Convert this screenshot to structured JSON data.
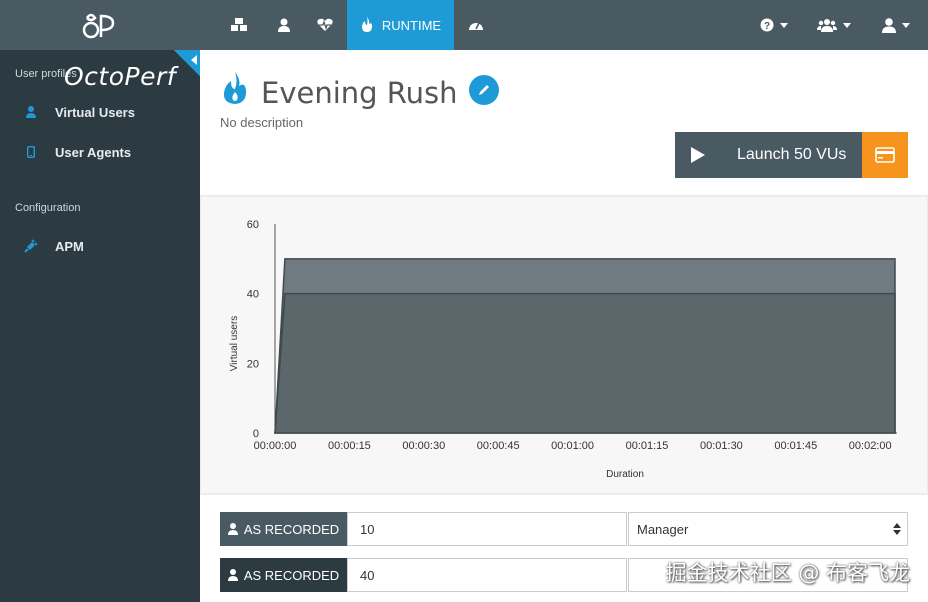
{
  "brand": {
    "name": "OctoPerf"
  },
  "topnav": {
    "items": [
      {
        "icon": "cubes-icon"
      },
      {
        "icon": "user-icon"
      },
      {
        "icon": "heartbeat-icon"
      },
      {
        "icon": "flame-icon",
        "label": "RUNTIME",
        "active": true
      },
      {
        "icon": "dashboard-icon"
      }
    ],
    "right": [
      {
        "icon": "help-icon"
      },
      {
        "icon": "team-icon"
      },
      {
        "icon": "account-icon"
      }
    ]
  },
  "sidebar": {
    "sections": [
      {
        "title": "User profiles",
        "items": [
          {
            "label": "Virtual Users",
            "icon": "user-icon"
          },
          {
            "label": "User Agents",
            "icon": "mobile-icon"
          }
        ]
      },
      {
        "title": "Configuration",
        "items": [
          {
            "label": "APM",
            "icon": "plug-icon"
          }
        ]
      }
    ]
  },
  "scenario": {
    "title": "Evening Rush",
    "description": "No description",
    "launch_label": "Launch 50 VUs"
  },
  "chart_data": {
    "type": "area",
    "xlabel": "Duration",
    "ylabel": "Virtual users",
    "x_ticks": [
      "00:00:00",
      "00:00:15",
      "00:00:30",
      "00:00:45",
      "00:01:00",
      "00:01:15",
      "00:01:30",
      "00:01:45",
      "00:02:00"
    ],
    "y_ticks": [
      0,
      20,
      40,
      60
    ],
    "xlim_seconds": [
      0,
      125
    ],
    "ylim": [
      0,
      60
    ],
    "series": [
      {
        "x_seconds": [
          0,
          2,
          125,
          125
        ],
        "values": [
          0,
          50,
          50,
          0
        ],
        "color": "#6f7b80"
      },
      {
        "x_seconds": [
          0,
          2,
          125,
          125
        ],
        "values": [
          0,
          40,
          40,
          0
        ],
        "color": "#5c676b"
      }
    ]
  },
  "rows": [
    {
      "profile": "AS RECORDED",
      "vus": "10",
      "user": "Manager"
    },
    {
      "profile": "AS RECORDED",
      "vus": "40",
      "user": ""
    }
  ],
  "watermark": "掘金技术社区 @ 布客飞龙"
}
